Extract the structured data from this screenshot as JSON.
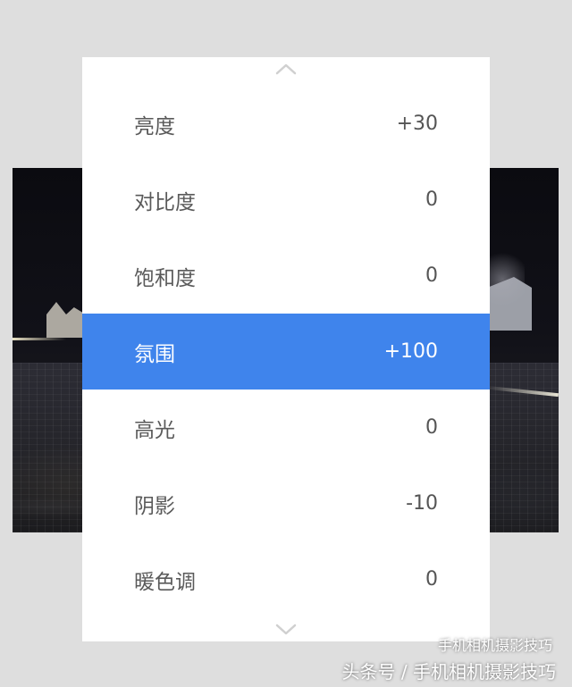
{
  "adjustments": [
    {
      "label": "亮度",
      "value": "+30",
      "selected": false
    },
    {
      "label": "对比度",
      "value": "0",
      "selected": false
    },
    {
      "label": "饱和度",
      "value": "0",
      "selected": false
    },
    {
      "label": "氛围",
      "value": "+100",
      "selected": true
    },
    {
      "label": "高光",
      "value": "0",
      "selected": false
    },
    {
      "label": "阴影",
      "value": "-10",
      "selected": false
    },
    {
      "label": "暖色调",
      "value": "0",
      "selected": false
    }
  ],
  "icons": {
    "scroll_up": "chevron-up-icon",
    "scroll_down": "chevron-down-icon"
  },
  "watermark": {
    "text": "头条号 / 手机相机摄影技巧",
    "badge": "手机相机摄影技巧"
  },
  "colors": {
    "selected_row": "#3f84ec",
    "panel_bg": "#ffffff",
    "page_bg": "#dedede"
  }
}
